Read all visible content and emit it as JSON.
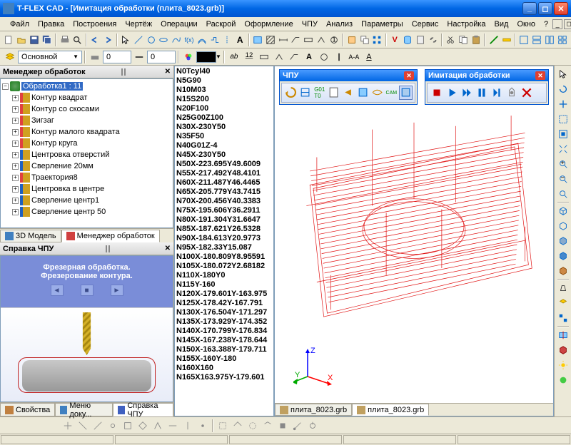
{
  "window": {
    "title": "T-FLEX CAD - [Имитация обработки (плита_8023.grb)]"
  },
  "menu": [
    "Файл",
    "Правка",
    "Построения",
    "Чертёж",
    "Операции",
    "Раскрой",
    "Оформление",
    "ЧПУ",
    "Анализ",
    "Параметры",
    "Сервис",
    "Настройка",
    "Вид",
    "Окно",
    "?"
  ],
  "layer_combo": "Основной",
  "spin1": "0",
  "spin2": "0",
  "manager": {
    "title": "Менеджер обработок",
    "root": "Обработка1 : 11",
    "items": [
      {
        "label": "Контур квадрат",
        "type": "mill"
      },
      {
        "label": "Контур со скосами",
        "type": "mill"
      },
      {
        "label": "Зигзаг",
        "type": "mill"
      },
      {
        "label": "Контур малого квадрата",
        "type": "mill"
      },
      {
        "label": "Контур круга",
        "type": "mill"
      },
      {
        "label": "Центровка отверстий",
        "type": "drill"
      },
      {
        "label": "Сверление 20мм",
        "type": "drill"
      },
      {
        "label": "Траектория8",
        "type": "mill"
      },
      {
        "label": "Центровка в центре",
        "type": "drill"
      },
      {
        "label": "Сверление центр1",
        "type": "drill"
      },
      {
        "label": "Сверление центр 50",
        "type": "drill"
      }
    ],
    "tabs": [
      "3D Модель",
      "Менеджер обработок"
    ]
  },
  "help": {
    "title": "Справка ЧПУ",
    "line1": "Фрезерная обработка.",
    "line2": "Фрезерование контура."
  },
  "bottom_tabs": [
    "Свойства",
    "Меню доку...",
    "Справка ЧПУ"
  ],
  "gcode": [
    "N0Tcyl40",
    "N5G90",
    "N10M03",
    "N15S200",
    "N20F100",
    "N25G00Z100",
    "N30X-230Y50",
    "N35F50",
    "N40G01Z-4",
    "N45X-230Y50",
    "N50X-223.695Y49.6009",
    "N55X-217.492Y48.4101",
    "N60X-211.487Y46.4465",
    "N65X-205.779Y43.7415",
    "N70X-200.456Y40.3383",
    "N75X-195.606Y36.2911",
    "N80X-191.304Y31.6647",
    "N85X-187.621Y26.5328",
    "N90X-184.613Y20.9773",
    "N95X-182.33Y15.087",
    "N100X-180.809Y8.95591",
    "N105X-180.072Y2.68182",
    "N110X-180Y0",
    "N115Y-160",
    "N120X-179.601Y-163.975",
    "N125X-178.42Y-167.791",
    "N130X-176.504Y-171.297",
    "N135X-173.929Y-174.352",
    "N140X-170.799Y-176.834",
    "N145X-167.238Y-178.644",
    "N150X-163.388Y-179.711",
    "N155X-160Y-180",
    "N160X160",
    "N165X163.975Y-179.601"
  ],
  "float_cnc": {
    "title": "ЧПУ"
  },
  "float_sim": {
    "title": "Имитация обработки"
  },
  "file_tabs": [
    "плита_8023.grb",
    "плита_8023.grb"
  ],
  "axes": {
    "x": "X",
    "y": "Y",
    "z": "Z"
  }
}
